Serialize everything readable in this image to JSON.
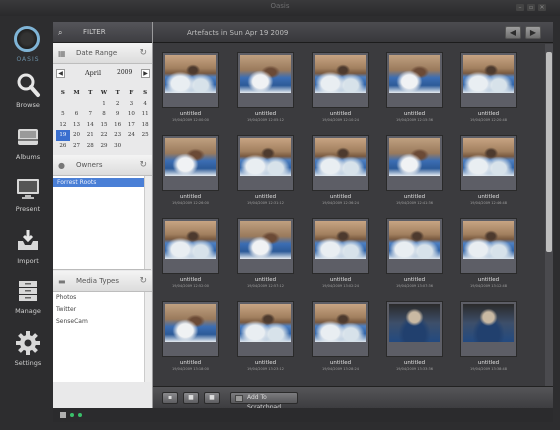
{
  "window": {
    "title": "Oasis",
    "controls": [
      "–",
      "▫",
      "✕"
    ]
  },
  "dock": {
    "logo_text": "OASIS",
    "items": [
      {
        "label": "Browse",
        "icon": "magnifier-icon"
      },
      {
        "label": "Albums",
        "icon": "album-tray-icon"
      },
      {
        "label": "Present",
        "icon": "monitor-icon"
      },
      {
        "label": "Import",
        "icon": "import-tray-icon"
      },
      {
        "label": "Manage",
        "icon": "storage-drawers-icon"
      },
      {
        "label": "Settings",
        "icon": "gear-icon"
      }
    ]
  },
  "filter": {
    "title": "FILTER",
    "date_range": {
      "title": "Date Range",
      "month": "April",
      "year": "2009",
      "weekdays": [
        "S",
        "M",
        "T",
        "W",
        "T",
        "F",
        "S"
      ],
      "weeks": [
        [
          "",
          "",
          "",
          "1",
          "2",
          "3",
          "4"
        ],
        [
          "5",
          "6",
          "7",
          "8",
          "9",
          "10",
          "11"
        ],
        [
          "12",
          "13",
          "14",
          "15",
          "16",
          "17",
          "18"
        ],
        [
          "19",
          "20",
          "21",
          "22",
          "23",
          "24",
          "25"
        ],
        [
          "26",
          "27",
          "28",
          "29",
          "30",
          "",
          ""
        ]
      ],
      "selected_day": "19"
    },
    "owners": {
      "title": "Owners",
      "items": [
        "Forrest Roots"
      ]
    },
    "media_types": {
      "title": "Media Types",
      "items": [
        "Photos",
        "Twitter",
        "SenseCam"
      ]
    }
  },
  "main": {
    "title": "Artefacts in Sun Apr 19 2009",
    "back_label": "◀",
    "forward_label": "▶",
    "tiles": [
      {
        "name": "untitled",
        "date": "19/04/2009 12:00:00"
      },
      {
        "name": "untitled",
        "date": "19/04/2009 12:05:12"
      },
      {
        "name": "untitled",
        "date": "19/04/2009 12:10:24"
      },
      {
        "name": "untitled",
        "date": "19/04/2009 12:15:36"
      },
      {
        "name": "untitled",
        "date": "19/04/2009 12:20:48"
      },
      {
        "name": "untitled",
        "date": "19/04/2009 12:26:00"
      },
      {
        "name": "untitled",
        "date": "19/04/2009 12:31:12"
      },
      {
        "name": "untitled",
        "date": "19/04/2009 12:36:24"
      },
      {
        "name": "untitled",
        "date": "19/04/2009 12:41:36"
      },
      {
        "name": "untitled",
        "date": "19/04/2009 12:46:48"
      },
      {
        "name": "untitled",
        "date": "19/04/2009 12:52:00"
      },
      {
        "name": "untitled",
        "date": "19/04/2009 12:57:12"
      },
      {
        "name": "untitled",
        "date": "19/04/2009 13:02:24"
      },
      {
        "name": "untitled",
        "date": "19/04/2009 13:07:36"
      },
      {
        "name": "untitled",
        "date": "19/04/2009 13:12:48"
      },
      {
        "name": "untitled",
        "date": "19/04/2009 13:18:00"
      },
      {
        "name": "untitled",
        "date": "19/04/2009 13:23:12"
      },
      {
        "name": "untitled",
        "date": "19/04/2009 13:28:24"
      },
      {
        "name": "untitled",
        "date": "19/04/2009 13:33:36"
      },
      {
        "name": "untitled",
        "date": "19/04/2009 13:38:48"
      }
    ],
    "footer": {
      "add_label": "Add To Scratchpad"
    }
  }
}
